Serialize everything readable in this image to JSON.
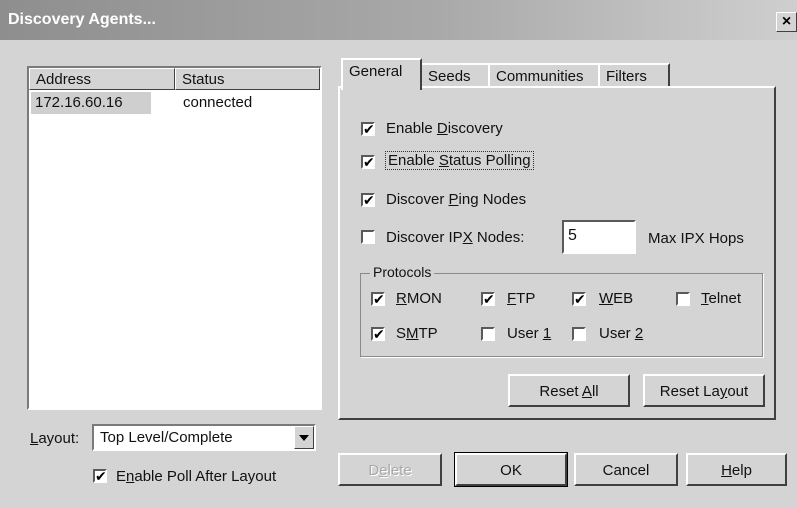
{
  "window": {
    "title": "Discovery Agents...",
    "close_glyph": "×"
  },
  "agents_list": {
    "columns": [
      "Address",
      "Status"
    ],
    "rows": [
      {
        "address": "172.16.60.16",
        "status": "connected"
      }
    ]
  },
  "layout_row": {
    "label_pre": "",
    "label_mnemonic": "L",
    "label_post": "ayout:",
    "value": "Top Level/Complete"
  },
  "enable_poll": {
    "pre": "E",
    "mnemonic": "n",
    "post": "able Poll After Layout",
    "checked": true
  },
  "tabs": [
    "General",
    "Seeds",
    "Communities",
    "Filters"
  ],
  "general": {
    "enable_discovery": {
      "pre": "Enable ",
      "mnemonic": "D",
      "post": "iscovery",
      "checked": true
    },
    "enable_status_polling": {
      "pre": "Enable ",
      "mnemonic": "S",
      "post": "tatus Polling",
      "checked": true
    },
    "discover_ping": {
      "pre": "Discover ",
      "mnemonic": "P",
      "post": "ing Nodes",
      "checked": true
    },
    "discover_ipx": {
      "pre": "Discover IP",
      "mnemonic": "X",
      "post": " Nodes:",
      "checked": false
    },
    "max_ipx_hops_value": "5",
    "max_ipx_hops_label": "Max IPX Hops"
  },
  "protocols": {
    "title": "Protocols",
    "rmon": {
      "pre": "",
      "mnemonic": "R",
      "post": "MON",
      "checked": true
    },
    "ftp": {
      "pre": "",
      "mnemonic": "F",
      "post": "TP",
      "checked": true
    },
    "web": {
      "pre": "",
      "mnemonic": "W",
      "post": "EB",
      "checked": true
    },
    "telnet": {
      "pre": "",
      "mnemonic": "T",
      "post": "elnet",
      "checked": false
    },
    "smtp": {
      "pre": "S",
      "mnemonic": "M",
      "post": "TP",
      "checked": true
    },
    "user1": {
      "pre": "User ",
      "mnemonic": "1",
      "post": "",
      "checked": false
    },
    "user2": {
      "pre": "User ",
      "mnemonic": "2",
      "post": "",
      "checked": false
    }
  },
  "buttons": {
    "reset_all": {
      "pre": "Reset ",
      "mnemonic": "A",
      "post": "ll"
    },
    "reset_layout": {
      "pre": "Reset La",
      "mnemonic": "y",
      "post": "out"
    },
    "delete": {
      "pre": "D",
      "mnemonic": "e",
      "post": "lete"
    },
    "ok": "OK",
    "cancel": "Cancel",
    "help": {
      "pre": "",
      "mnemonic": "H",
      "post": "elp"
    }
  },
  "check_glyph": "✔"
}
